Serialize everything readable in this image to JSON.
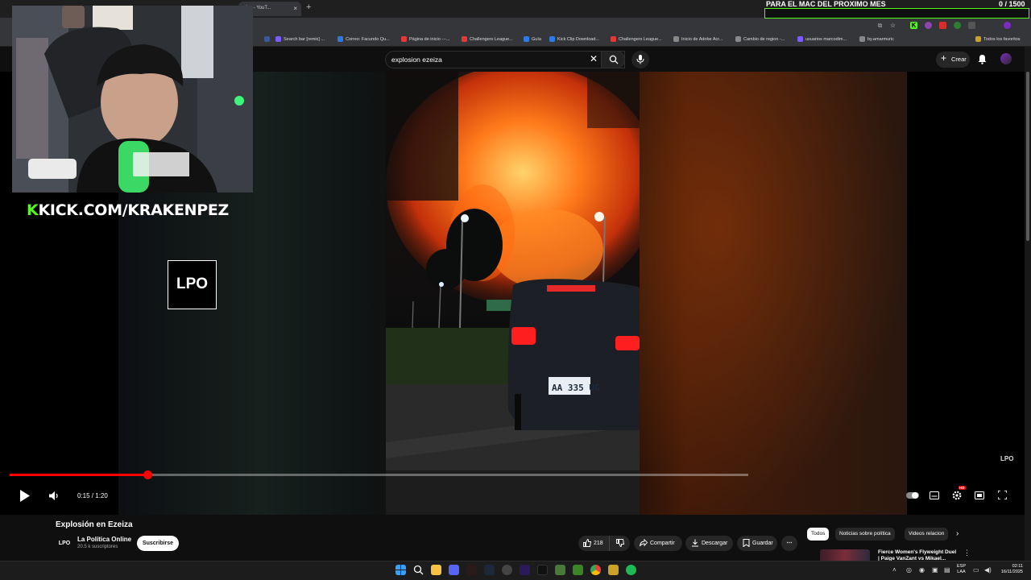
{
  "browser": {
    "tab_title": "eiza - YouT...",
    "bookmarks": [
      {
        "label": "Search bar [remix] ...",
        "color": "#7b5cff"
      },
      {
        "label": "Correo: Facundo Qu...",
        "color": "#2c7be5"
      },
      {
        "label": "Página de inicio ---...",
        "color": "#e53935"
      },
      {
        "label": "Challengers League...",
        "color": "#e53935"
      },
      {
        "label": "Guía",
        "color": "#2c7be5"
      },
      {
        "label": "Kick Clip Download...",
        "color": "#2c7be5"
      },
      {
        "label": "Challengers League...",
        "color": "#e53935"
      },
      {
        "label": "Inicio de Adobe Acr...",
        "color": "#888888"
      },
      {
        "label": "Cambio de region -...",
        "color": "#888888"
      },
      {
        "label": "usuarios marcodim...",
        "color": "#7b5cff"
      },
      {
        "label": "by.amarmuric",
        "color": "#888888"
      }
    ],
    "all_bookmarks": "Todos los favoritos"
  },
  "stream": {
    "goal_title": "PARA EL MAC DEL PROXIMO MES",
    "goal_count": "0 / 1500",
    "goal_progress": 0,
    "accent": "#53fc18",
    "kick_k": "K",
    "kick_url": "KICK.COM/KRAKENPEZ"
  },
  "youtube": {
    "search_value": "explosion ezeiza",
    "create_label": "Crear",
    "video": {
      "logo_text": "LPO",
      "watermark": "LPO",
      "time": "0:15 / 1:20",
      "played_fraction": 0.1875,
      "buffered_fraction": 1.0,
      "hd_badge": "HD"
    },
    "title": "Explosión en Ezeiza",
    "channel": {
      "avatar_text": "LPO",
      "name": "La Política Online",
      "subs": "20.5 k suscriptores",
      "subscribe": "Suscribirse"
    },
    "actions": {
      "likes": "218",
      "share": "Compartir",
      "download": "Descargar",
      "save": "Guardar"
    },
    "chips": [
      "Todos",
      "Noticias sobre política",
      "Videos relacion"
    ],
    "recommended_title": "Fierce Women's Flyweight Duel | Paige VanZant vs Mikael..."
  },
  "taskbar": {
    "lang": "ESP",
    "lang2": "LAA",
    "time": "02:11",
    "date": "16/11/2025"
  }
}
